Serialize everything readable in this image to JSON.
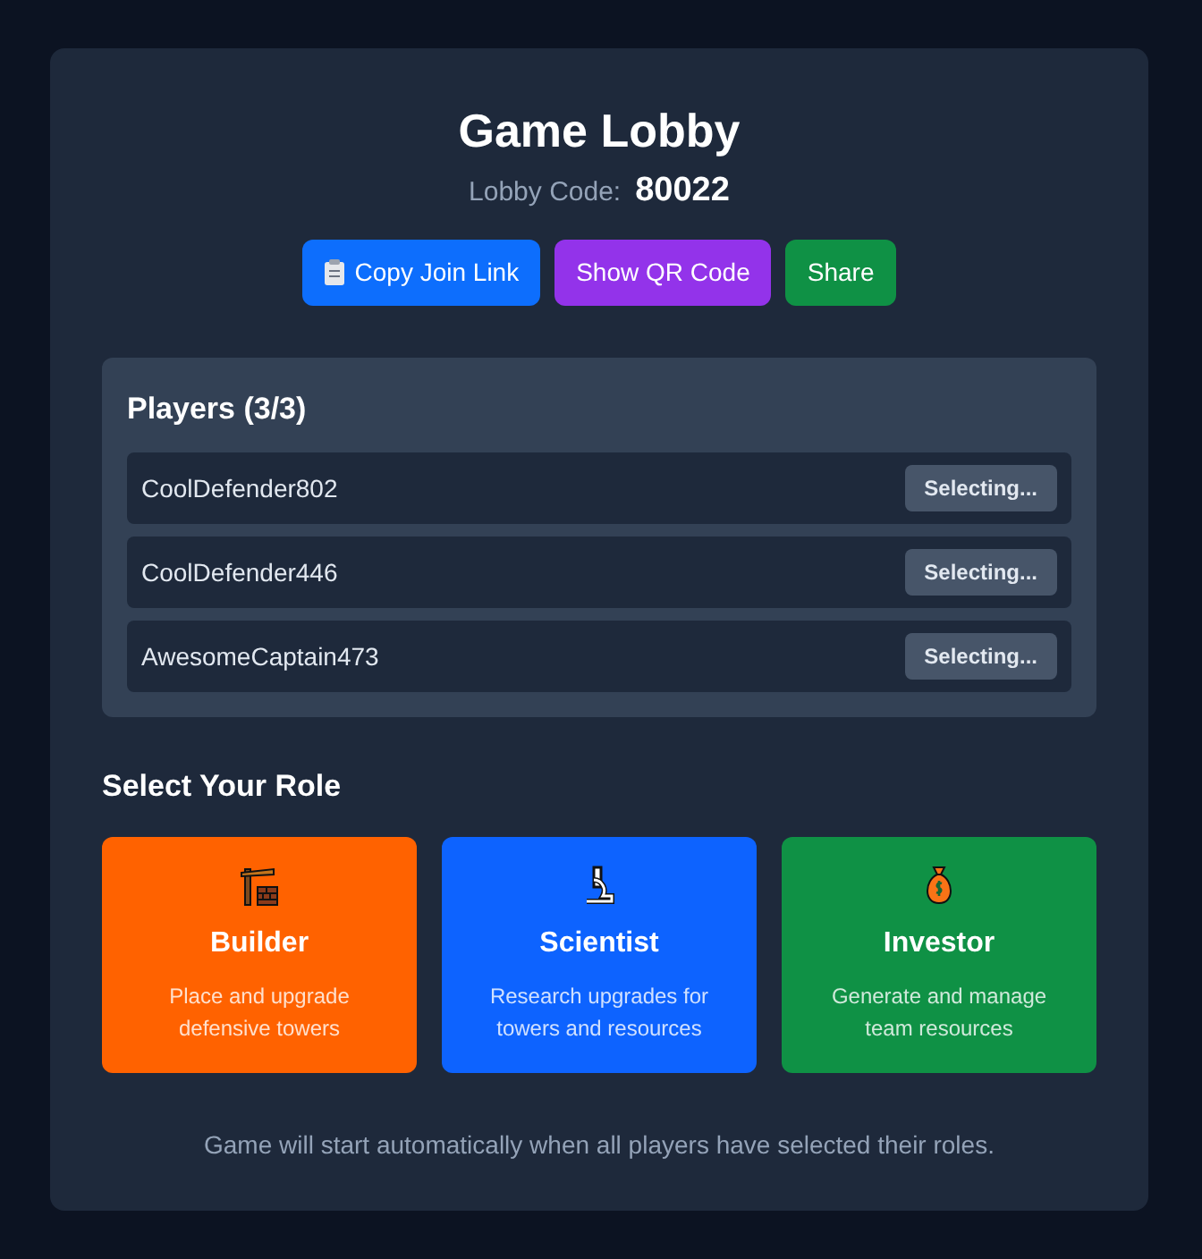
{
  "title": "Game Lobby",
  "lobby_code": {
    "label": "Lobby Code:",
    "value": "80022"
  },
  "buttons": [
    {
      "label": "Copy Join Link",
      "color": "#0d6efd"
    },
    {
      "label": "Show QR Code",
      "color": "#9333ea"
    },
    {
      "label": "Share",
      "color": "#0f9145"
    }
  ],
  "players": {
    "title": "Players (3/3)",
    "items": [
      {
        "name": "CoolDefender802",
        "status": "Selecting..."
      },
      {
        "name": "CoolDefender446",
        "status": "Selecting..."
      },
      {
        "name": "AwesomeCaptain473",
        "status": "Selecting..."
      }
    ]
  },
  "roles_title": "Select Your Role",
  "roles": [
    {
      "name": "Builder",
      "description": "Place and upgrade defensive towers",
      "color": "#ff6200"
    },
    {
      "name": "Scientist",
      "description": "Research upgrades for towers and resources",
      "color": "#0d63ff"
    },
    {
      "name": "Investor",
      "description": "Generate and manage team resources",
      "color": "#0f9145"
    }
  ],
  "footer": "Game will start automatically when all players have selected their roles."
}
